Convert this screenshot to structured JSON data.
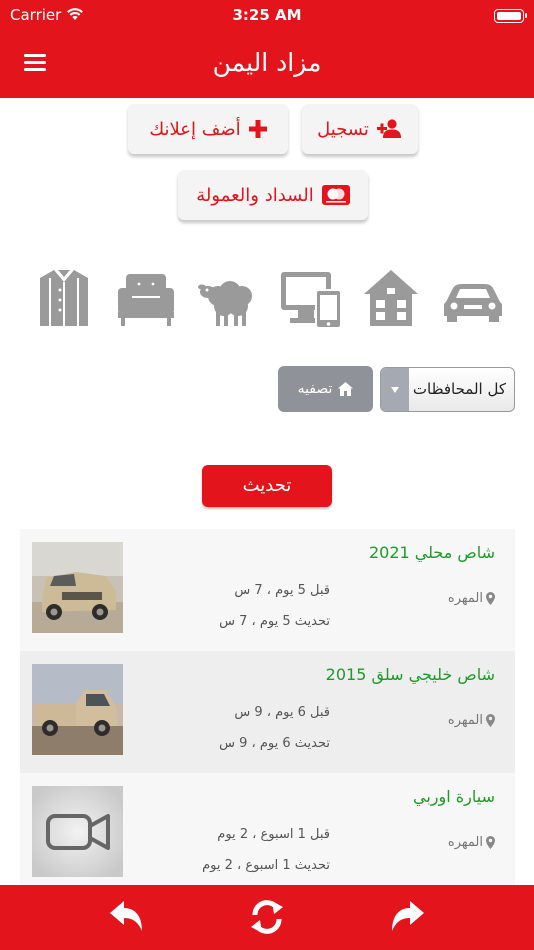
{
  "status_bar": {
    "carrier": "Carrier",
    "time": "3:25 AM",
    "battery_level": 1.0
  },
  "header": {
    "title": "مزاد اليمن",
    "menu_icon": "hamburger-menu-icon"
  },
  "actions": {
    "register_label": "تسجيل",
    "add_ad_label": "أضف إعلانك",
    "payment_label": "السداد والعمولة"
  },
  "categories": [
    {
      "name": "cars",
      "icon": "car-icon"
    },
    {
      "name": "real-estate",
      "icon": "house-icon"
    },
    {
      "name": "electronics",
      "icon": "devices-icon"
    },
    {
      "name": "livestock",
      "icon": "sheep-icon"
    },
    {
      "name": "furniture",
      "icon": "sofa-icon"
    },
    {
      "name": "clothing",
      "icon": "shirt-icon"
    }
  ],
  "filter": {
    "governorate": "كل المحافظات",
    "filter_label": "تصفيه"
  },
  "refresh_label": "تحديث",
  "listings": [
    {
      "title": "شاص محلي 2021",
      "location": "المهره",
      "posted": "قبل 5 يوم ، 7 س",
      "updated": "تحديث 5 يوم ، 7 س",
      "image": "photo"
    },
    {
      "title": "شاص خليجي سلق 2015",
      "location": "المهره",
      "posted": "قبل 6 يوم ، 9 س",
      "updated": "تحديث 6 يوم ، 9 س",
      "image": "photo"
    },
    {
      "title": "سيارة اوربي",
      "location": "المهره",
      "posted": "قبل 1 اسبوع ، 2 يوم",
      "updated": "تحديث 1 اسبوع ، 2 يوم",
      "image": "video"
    }
  ],
  "bottom_bar": {
    "icons": [
      "back-arrow-icon",
      "refresh-icon",
      "forward-arrow-icon"
    ]
  },
  "colors": {
    "brand": "#e3141b",
    "title_green": "#1f9a2a",
    "icon_gray": "#9a9a9a"
  }
}
